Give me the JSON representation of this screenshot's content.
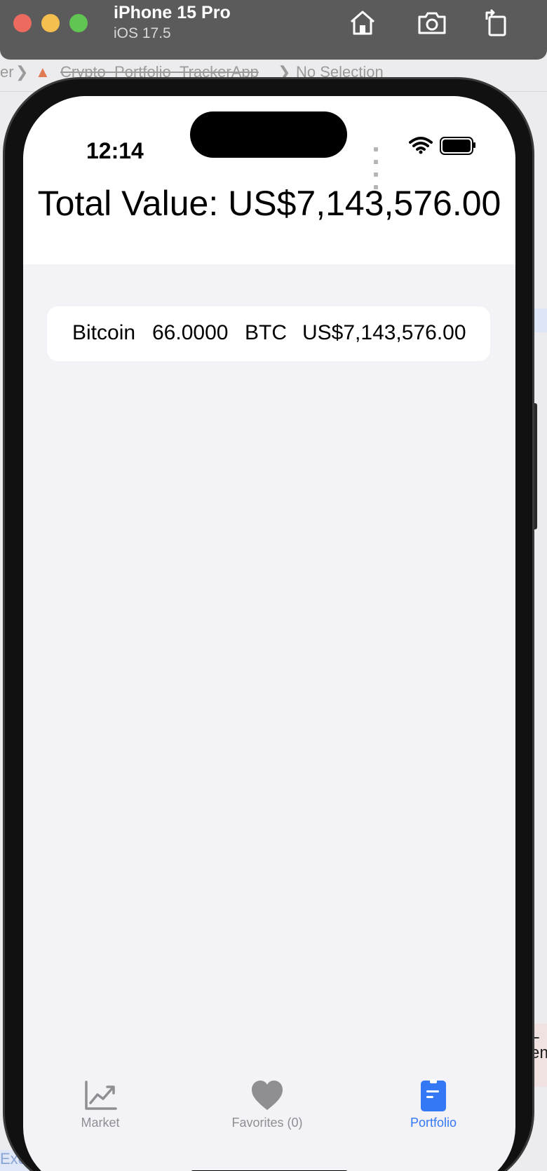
{
  "window": {
    "device_name": "iPhone 15 Pro",
    "os_version": "iOS 17.5",
    "toolbar_icons": [
      "home-icon",
      "screenshot-icon",
      "rotate-icon"
    ]
  },
  "xcode": {
    "breadcrumb_prefix": "er",
    "breadcrumb_app": "Crypto_Portfolio_TrackerApp",
    "breadcrumb_selection": "No Selection",
    "right_fragment": "L em",
    "bottom_fragment": "Exe"
  },
  "status_bar": {
    "time": "12:14",
    "icons": [
      "signal-dots-icon",
      "wifi-icon",
      "battery-icon"
    ],
    "battery_level": 1.0
  },
  "portfolio": {
    "total_value": "Total Value: US$7,143,576.00",
    "holdings": [
      {
        "name": "Bitcoin",
        "amount": "66.0000",
        "symbol": "BTC",
        "value": "US$7,143,576.00"
      }
    ]
  },
  "tabbar": {
    "tabs": [
      {
        "label": "Market",
        "icon": "chart-line-icon",
        "selected": false
      },
      {
        "label": "Favorites (0)",
        "icon": "heart-icon",
        "selected": false
      },
      {
        "label": "Portfolio",
        "icon": "clipboard-icon",
        "selected": true
      }
    ]
  },
  "colors": {
    "accent": "#3478f6",
    "inactive_tab": "#8e8e93",
    "background": "#f2f2f7"
  }
}
